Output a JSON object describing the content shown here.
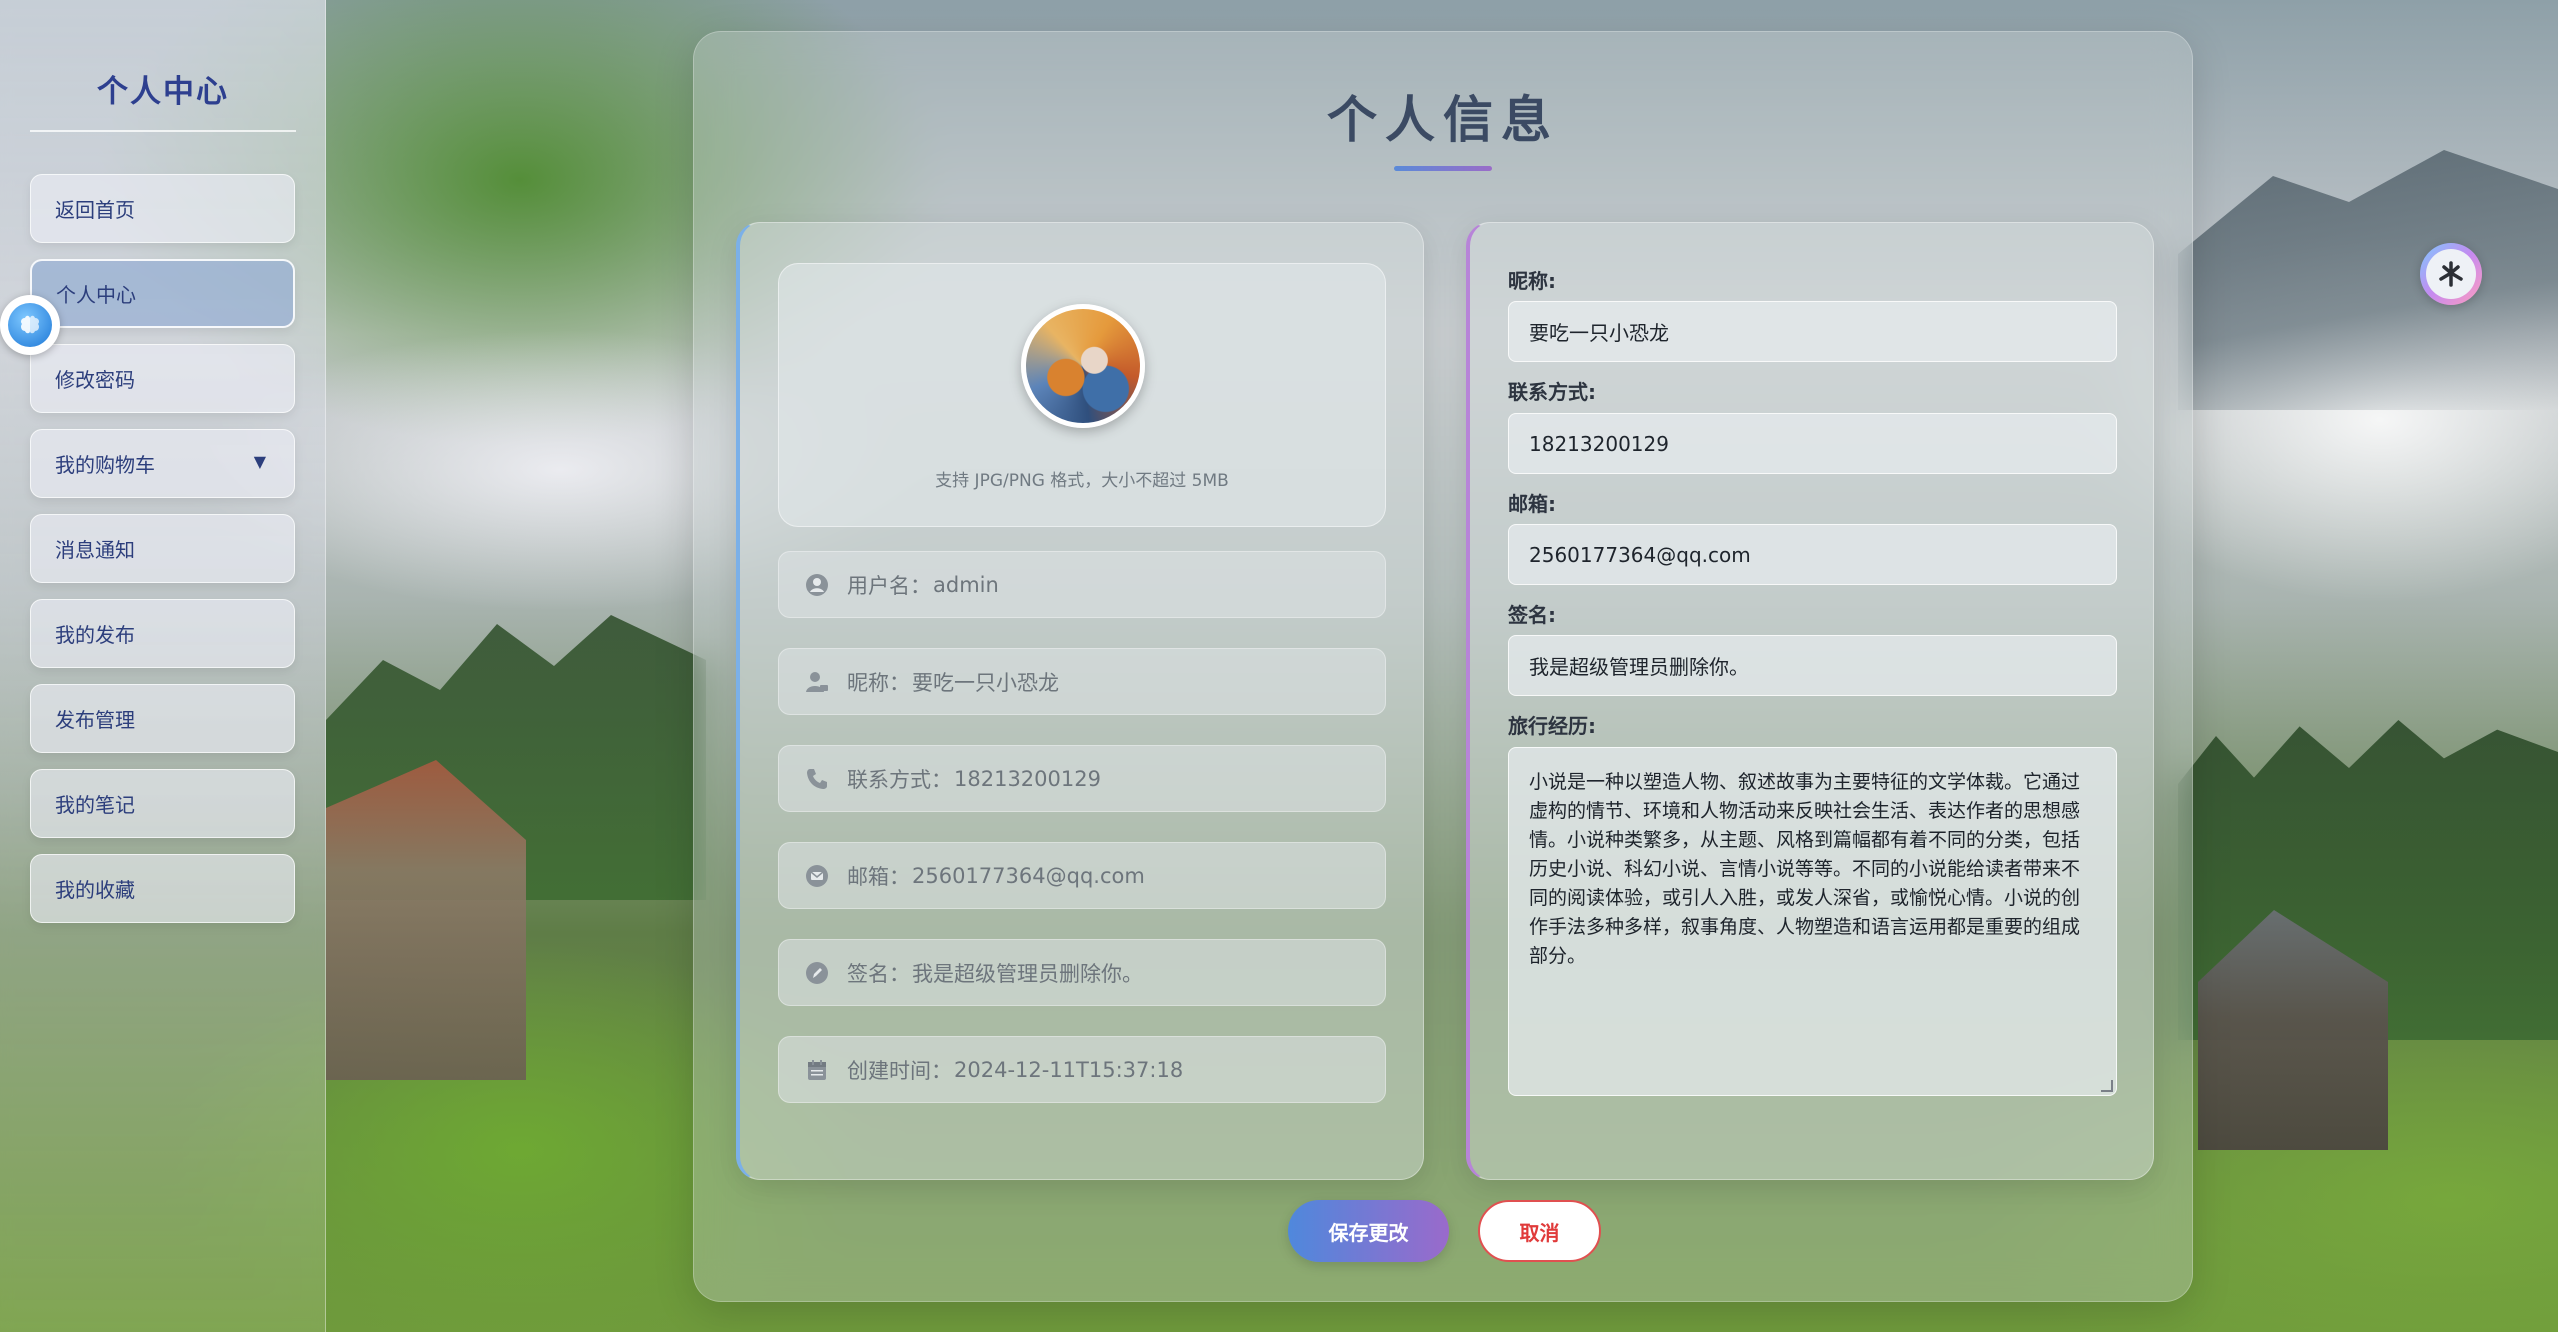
{
  "sidebar": {
    "title": "个人中心",
    "items": [
      {
        "label": "返回首页"
      },
      {
        "label": "个人中心"
      },
      {
        "label": "修改密码"
      },
      {
        "label": "我的购物车",
        "arrow": "▼"
      },
      {
        "label": "消息通知"
      },
      {
        "label": "我的发布"
      },
      {
        "label": "发布管理"
      },
      {
        "label": "我的笔记"
      },
      {
        "label": "我的收藏"
      }
    ],
    "active_item": "个人中心"
  },
  "page": {
    "title": "个人信息"
  },
  "profile_card": {
    "avatar_hint": "支持 JPG/PNG 格式，大小不超过 5MB",
    "rows": [
      {
        "icon": "user-icon",
        "label": "用户名：",
        "value": "admin"
      },
      {
        "icon": "user-tag-icon",
        "label": "昵称：",
        "value": "要吃一只小恐龙"
      },
      {
        "icon": "phone-icon",
        "label": "联系方式：",
        "value": "18213200129"
      },
      {
        "icon": "mail-icon",
        "label": "邮箱：",
        "value": "2560177364@qq.com"
      },
      {
        "icon": "pen-icon",
        "label": "签名：",
        "value": "我是超级管理员删除你。"
      },
      {
        "icon": "calendar-icon",
        "label": "创建时间：",
        "value": "2024-12-11T15:37:18"
      }
    ]
  },
  "edit_form": {
    "nickname_label": "昵称:",
    "nickname_value": "要吃一只小恐龙",
    "contact_label": "联系方式:",
    "contact_value": "18213200129",
    "email_label": "邮箱:",
    "email_value": "2560177364@qq.com",
    "signature_label": "签名:",
    "signature_value": "我是超级管理员删除你。",
    "travel_label": "旅行经历:",
    "travel_value": "小说是一种以塑造人物、叙述故事为主要特征的文学体裁。它通过虚构的情节、环境和人物活动来反映社会生活、表达作者的思想感情。小说种类繁多，从主题、风格到篇幅都有着不同的分类，包括历史小说、科幻小说、言情小说等等。不同的小说能给读者带来不同的阅读体验，或引人入胜，或发人深省，或愉悦心情。小说的创作手法多种多样，叙事角度、人物塑造和语言运用都是重要的组成部分。"
  },
  "actions": {
    "save_label": "保存更改",
    "cancel_label": "取消"
  },
  "colors": {
    "accent_blue": "#4f88dc",
    "accent_purple": "#9a6acb",
    "title_navy": "#2d3f8f",
    "cancel_red": "#e03a3a"
  }
}
